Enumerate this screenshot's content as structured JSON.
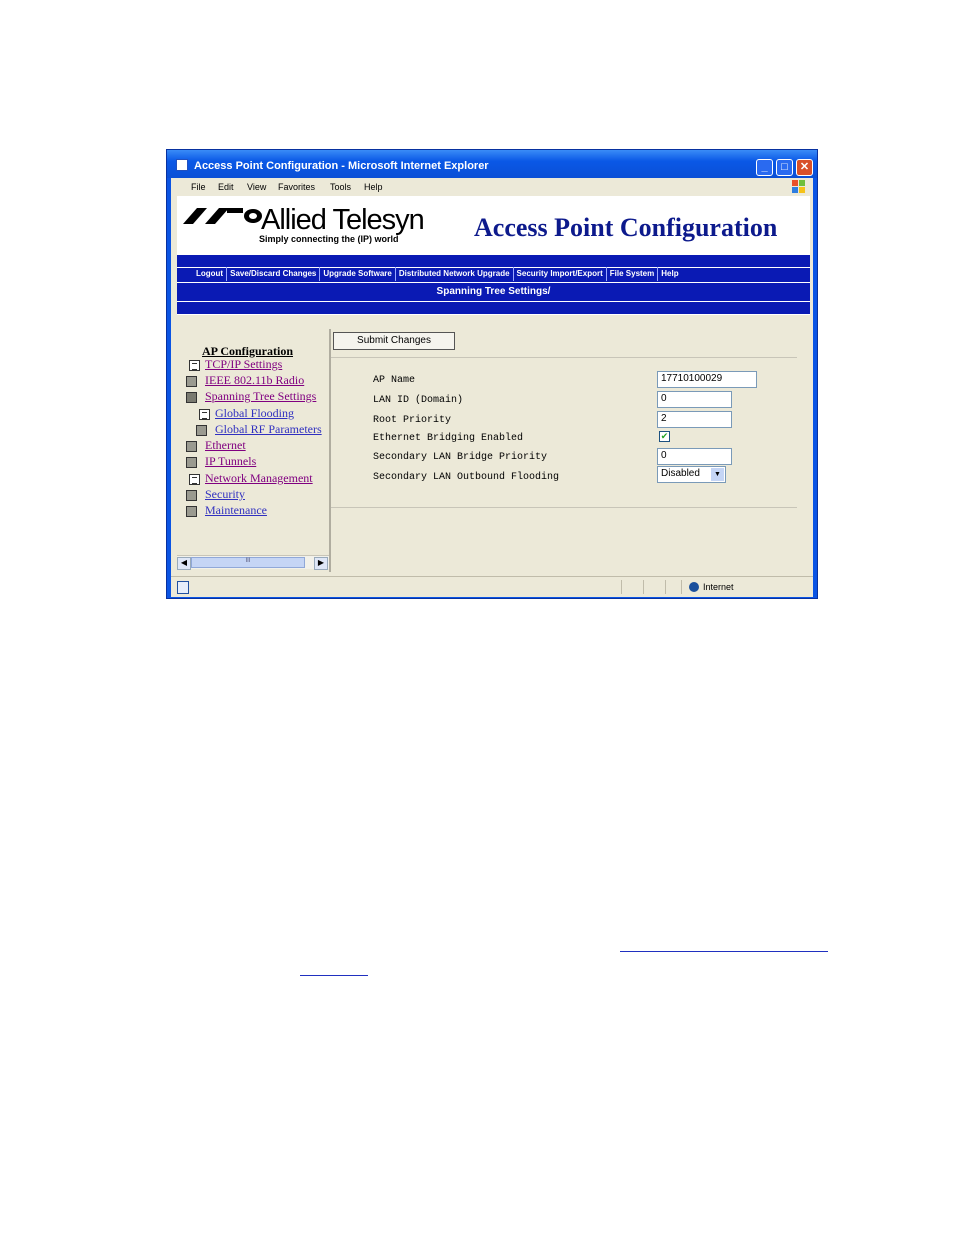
{
  "window": {
    "title": "Access Point Configuration - Microsoft Internet Explorer",
    "controls": {
      "minimize": "_",
      "maximize": "□",
      "close": "✕"
    }
  },
  "menubar": [
    "File",
    "Edit",
    "View",
    "Favorites",
    "Tools",
    "Help"
  ],
  "banner": {
    "brand_name": "Allied Telesyn",
    "brand_tagline": "Simply connecting the (IP) world",
    "heading": "Access Point Configuration"
  },
  "nav": [
    "Logout",
    "Save/Discard Changes",
    "Upgrade Software",
    "Distributed Network Upgrade",
    "Security Import/Export",
    "File System",
    "Help"
  ],
  "section_title": "Spanning Tree Settings/",
  "sidebar": {
    "title": "AP Configuration",
    "items": [
      {
        "label": "TCP/IP Settings",
        "icon": "document-icon"
      },
      {
        "label": "IEEE 802.11b Radio",
        "icon": "folder-icon"
      },
      {
        "label": "Spanning Tree Settings",
        "icon": "open-folder-icon"
      },
      {
        "label": "Global Flooding",
        "icon": "document-icon"
      },
      {
        "label": "Global RF Parameters",
        "icon": "folder-icon"
      },
      {
        "label": "Ethernet",
        "icon": "folder-icon"
      },
      {
        "label": "IP Tunnels",
        "icon": "folder-icon"
      },
      {
        "label": "Network Management",
        "icon": "document-icon"
      },
      {
        "label": "Security",
        "icon": "folder-icon"
      },
      {
        "label": "Maintenance",
        "icon": "folder-icon"
      }
    ]
  },
  "form": {
    "submit_label": "Submit Changes",
    "ap_name_label": "AP Name",
    "ap_name_value": "17710100029",
    "lan_id_label": "LAN ID (Domain)",
    "lan_id_value": "0",
    "root_priority_label": "Root Priority",
    "root_priority_value": "2",
    "ethernet_bridging_label": "Ethernet Bridging Enabled",
    "ethernet_bridging_checked": true,
    "secondary_priority_label": "Secondary LAN Bridge Priority",
    "secondary_priority_value": "0",
    "outbound_flooding_label": "Secondary LAN Outbound Flooding",
    "outbound_flooding_value": "Disabled"
  },
  "status": {
    "zone": "Internet"
  },
  "colors": {
    "xp_blue": "#0a54e4",
    "nav_blue": "#0a1ab4",
    "heading_navy": "#0d1a8c"
  }
}
